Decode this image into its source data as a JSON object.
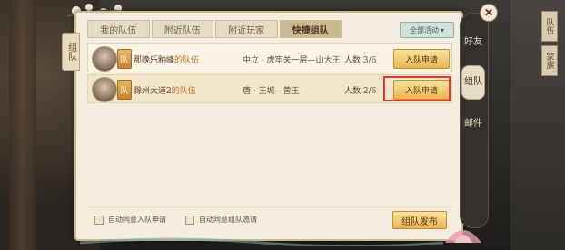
{
  "panel": {
    "left_tab": "组队",
    "tabs": [
      {
        "label": "我的队伍",
        "active": false
      },
      {
        "label": "附近队伍",
        "active": false
      },
      {
        "label": "附近玩家",
        "active": false
      },
      {
        "label": "快捷组队",
        "active": true
      }
    ],
    "filter": {
      "label": "全部活动",
      "icon": "chevron-down-icon"
    }
  },
  "teams": [
    {
      "badge": "队",
      "name": "那晚乐釉峰",
      "suffix": "的队伍",
      "location": "中立 · 虎牢关一层—山大王",
      "count_label": "人数",
      "count": "3/6",
      "join_label": "入队申请"
    },
    {
      "badge": "队",
      "name": "滁州大道2",
      "suffix": "的队伍",
      "location": "唐 · 王城—兽王",
      "count_label": "人数",
      "count": "2/6",
      "join_label": "入队申请"
    }
  ],
  "footer": {
    "auto_accept_join": "自动同意入队申请",
    "auto_accept_invite": "自动同意组队邀请",
    "publish": "组队发布"
  },
  "sidenav": [
    {
      "label": "好友",
      "active": false
    },
    {
      "label": "组队",
      "active": true
    },
    {
      "label": "邮件",
      "active": false
    }
  ],
  "right_edge": [
    "队伍",
    "家族"
  ],
  "colors": {
    "highlight": "#e03a3a",
    "accent": "#eab553"
  }
}
